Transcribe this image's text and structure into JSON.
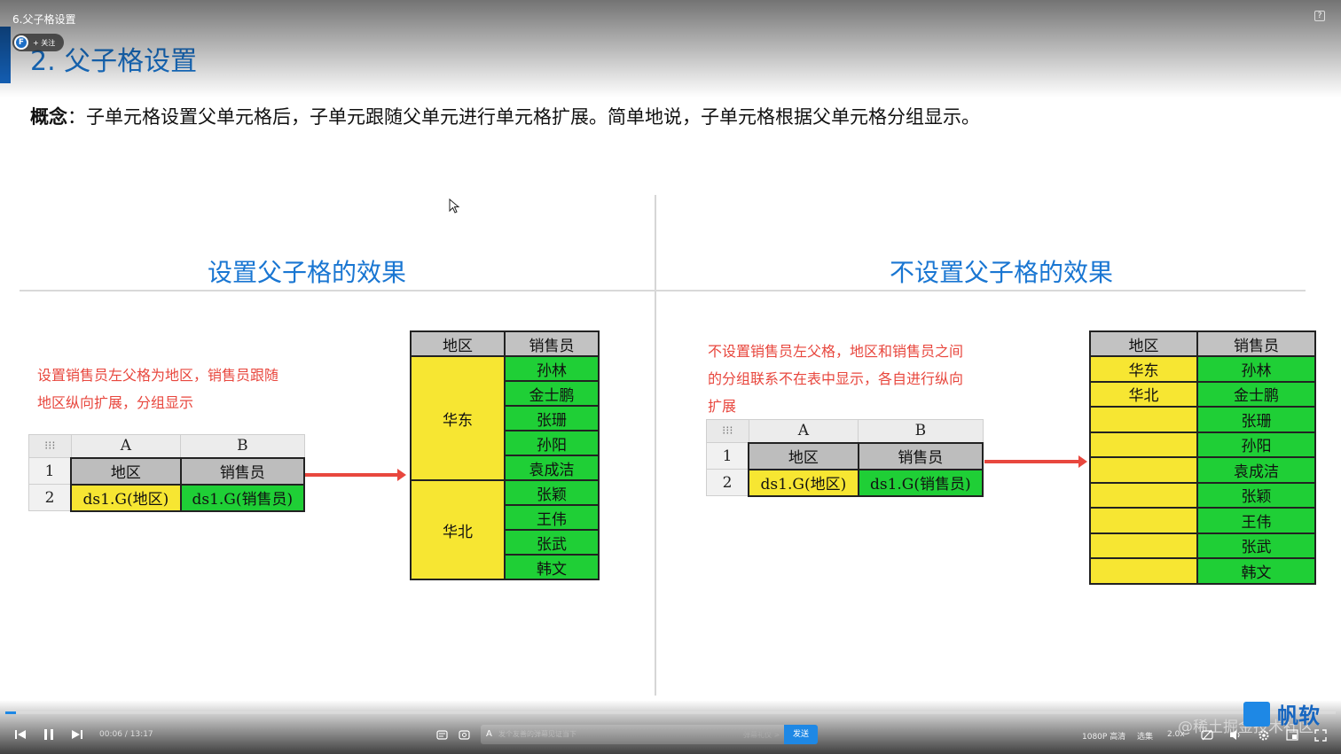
{
  "video": {
    "title": "6.父子格设置",
    "follow_label": "+ 关注",
    "current_time": "00:06",
    "total_time": "13:17",
    "progress_fraction": 0.008,
    "danmaku_placeholder": "发个友善的弹幕见证当下",
    "danmaku_etiquette": "弹幕礼仪 >",
    "send_label": "发送",
    "quality": "1080P 高清",
    "episodes": "选集",
    "speed": "2.0x",
    "watermark": "@稀土掘金技术社区",
    "logo_text": "帆软"
  },
  "slide": {
    "title": "2. 父子格设置",
    "concept_label": "概念",
    "concept_text": "：子单元格设置父单元格后，子单元跟随父单元进行单元格扩展。简单地说，子单元格根据父单元格分组显示。",
    "left": {
      "heading": "设置父子格的效果",
      "note_lines": [
        "设置销售员左父格为地区，销售员跟随",
        "地区纵向扩展，分组显示"
      ],
      "grid": {
        "col_a": "A",
        "col_b": "B",
        "row1": "1",
        "row2": "2",
        "head_a": "地区",
        "head_b": "销售员",
        "cell_a": "ds1.G(地区)",
        "cell_b": "ds1.G(销售员)"
      },
      "result": {
        "headers": [
          "地区",
          "销售员"
        ],
        "groups": [
          {
            "region": "华东",
            "sales": [
              "孙林",
              "金士鹏",
              "张珊",
              "孙阳",
              "袁成洁"
            ]
          },
          {
            "region": "华北",
            "sales": [
              "张颖",
              "王伟",
              "张武",
              "韩文"
            ]
          }
        ]
      }
    },
    "right": {
      "heading": "不设置父子格的效果",
      "note_lines": [
        "不设置销售员左父格，地区和销售员之间",
        "的分组联系不在表中显示，各自进行纵向",
        "扩展"
      ],
      "grid": {
        "col_a": "A",
        "col_b": "B",
        "row1": "1",
        "row2": "2",
        "head_a": "地区",
        "head_b": "销售员",
        "cell_a": "ds1.G(地区)",
        "cell_b": "ds1.G(销售员)"
      },
      "result": {
        "headers": [
          "地区",
          "销售员"
        ],
        "regions": [
          "华东",
          "华北",
          "",
          "",
          "",
          "",
          "",
          "",
          ""
        ],
        "sales": [
          "孙林",
          "金士鹏",
          "张珊",
          "孙阳",
          "袁成洁",
          "张颖",
          "王伟",
          "张武",
          "韩文"
        ]
      }
    }
  }
}
